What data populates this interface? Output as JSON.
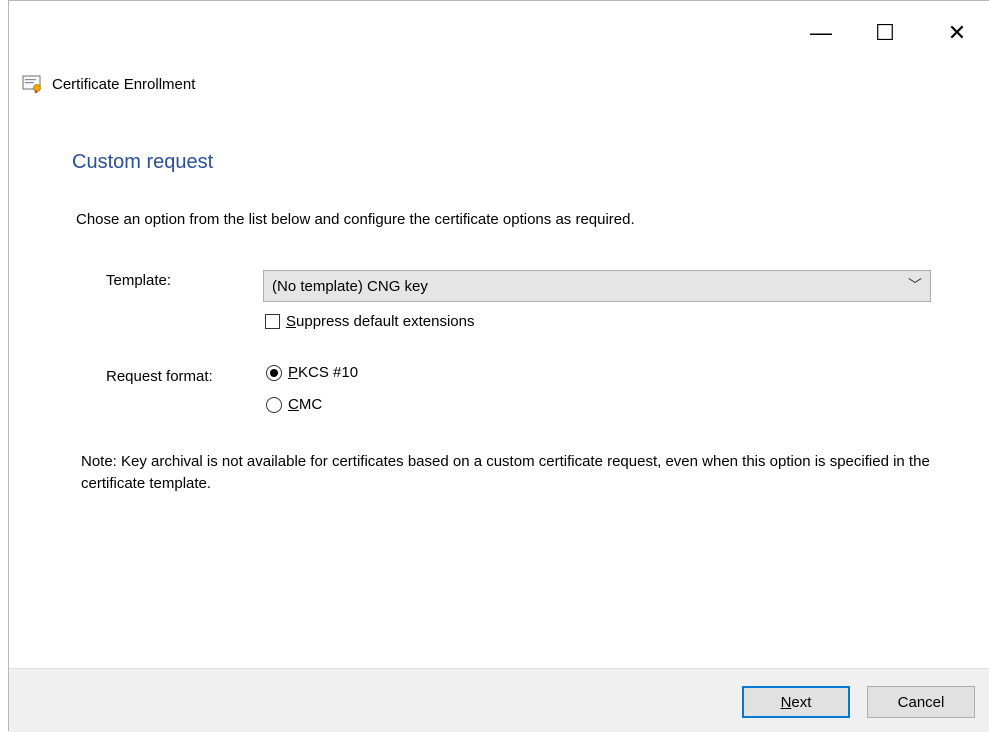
{
  "window": {
    "title": "Certificate Enrollment",
    "minimize_glyph": "—",
    "maximize_glyph": "☐",
    "close_glyph": "✕"
  },
  "page": {
    "heading": "Custom request",
    "instructions": "Chose an option from the list below and configure the certificate options as required."
  },
  "template": {
    "label": "Template:",
    "selected": "(No template) CNG key",
    "suppress_label": "Suppress default extensions",
    "suppress_accel": "S",
    "suppress_rest": "uppress default extensions",
    "suppress_checked": false
  },
  "request_format": {
    "label": "Request format:",
    "options": [
      {
        "label": "PKCS #10",
        "accel": "P",
        "rest": "KCS #10",
        "selected": true
      },
      {
        "label": "CMC",
        "accel": "C",
        "rest": "MC",
        "selected": false
      }
    ]
  },
  "note": "Note: Key archival is not available for certificates based on a custom certificate request, even when this option is specified in the certificate template.",
  "buttons": {
    "next": "Next",
    "next_accel": "N",
    "next_rest": "ext",
    "cancel": "Cancel"
  },
  "colors": {
    "heading": "#2a4f9e",
    "default_button_border": "#0078d7",
    "footer_bg": "#f0f0f0"
  },
  "icons": [
    "certificate-icon",
    "chevron-down-icon",
    "minimize-icon",
    "maximize-icon",
    "close-icon"
  ]
}
